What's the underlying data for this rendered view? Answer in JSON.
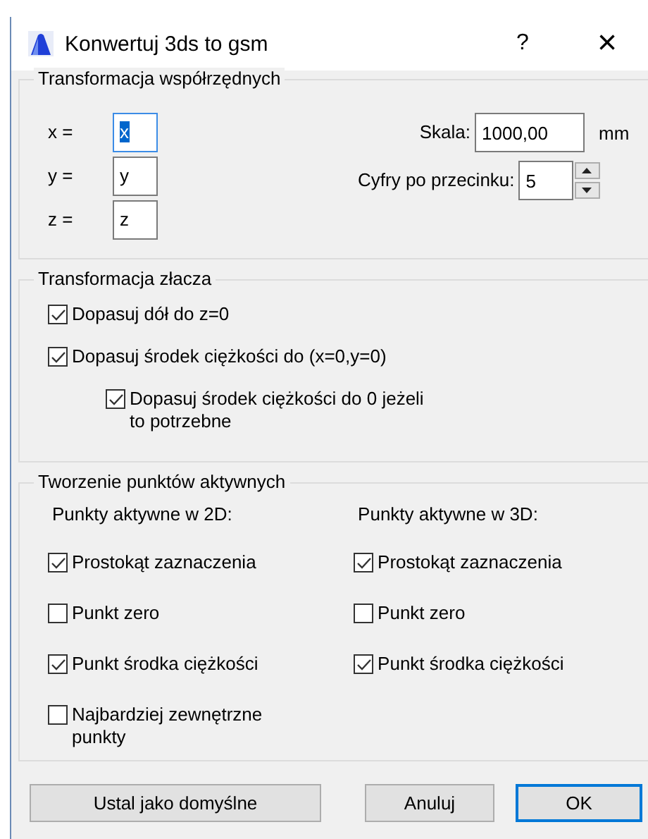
{
  "window": {
    "title": "Konwertuj 3ds to gsm",
    "help": "?",
    "close": "×"
  },
  "coordinates": {
    "title": "Transformacja współrzędnych",
    "axes": [
      {
        "label": "x =",
        "value": "x",
        "focused": true
      },
      {
        "label": "y =",
        "value": "y",
        "focused": false
      },
      {
        "label": "z =",
        "value": "z",
        "focused": false
      }
    ],
    "scale": {
      "label": "Skala:",
      "value": "1000,00",
      "unit": "mm"
    },
    "decimals": {
      "label": "Cyfry po przecinku:",
      "value": "5"
    }
  },
  "joint": {
    "title": "Transformacja złacza",
    "options": [
      {
        "label": "Dopasuj dół do z=0",
        "checked": true
      },
      {
        "label": "Dopasuj środek ciężkości do (x=0,y=0)",
        "checked": true,
        "children": [
          {
            "label": "Dopasuj środek ciężkości do 0 jeżeli to potrzebne",
            "checked": true
          }
        ]
      }
    ]
  },
  "hotspots": {
    "title": "Tworzenie punktów aktywnych",
    "columns": [
      {
        "heading": "Punkty aktywne w 2D:",
        "options": [
          {
            "label": "Prostokąt zaznaczenia",
            "checked": true
          },
          {
            "label": "Punkt zero",
            "checked": false
          },
          {
            "label": "Punkt środka ciężkości",
            "checked": true
          },
          {
            "label": "Najbardziej zewnętrzne punkty",
            "checked": false
          }
        ]
      },
      {
        "heading": "Punkty aktywne w 3D:",
        "options": [
          {
            "label": "Prostokąt zaznaczenia",
            "checked": true
          },
          {
            "label": "Punkt zero",
            "checked": false
          },
          {
            "label": "Punkt środka ciężkości",
            "checked": true
          }
        ]
      }
    ]
  },
  "buttons": [
    {
      "label": "Ustal jako domyślne",
      "default": false
    },
    {
      "label": "Anuluj",
      "default": false
    },
    {
      "label": "OK",
      "default": true
    }
  ]
}
